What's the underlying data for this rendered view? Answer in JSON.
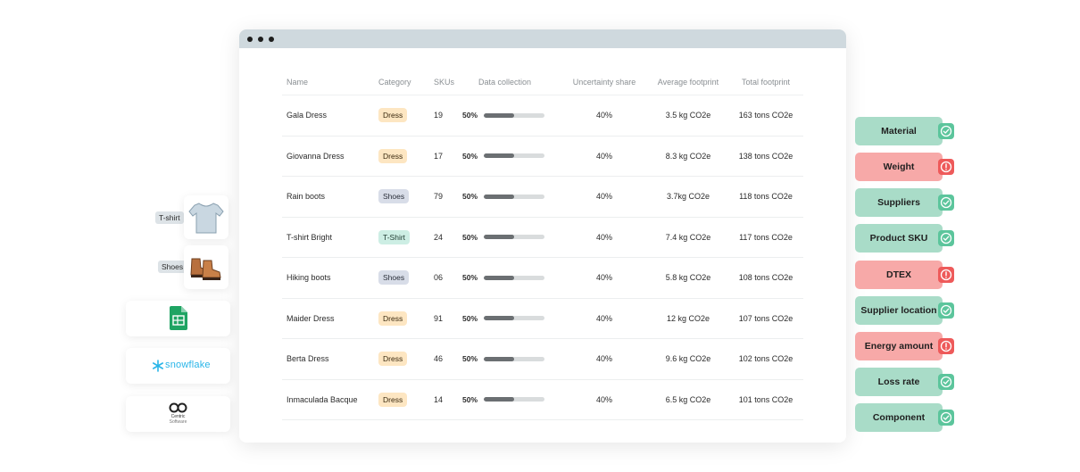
{
  "table": {
    "headers": [
      "Name",
      "Category",
      "SKUs",
      "Data collection",
      "Uncertainty share",
      "Average footprint",
      "Total footprint"
    ],
    "rows": [
      {
        "name": "Gala Dress",
        "category": "Dress",
        "cat_type": "dress",
        "skus": "19",
        "data_pct": "50%",
        "data_fill": 0.5,
        "uncertainty": "40%",
        "avg": "3.5 kg CO2e",
        "total": "163 tons CO2e"
      },
      {
        "name": "Giovanna Dress",
        "category": "Dress",
        "cat_type": "dress",
        "skus": "17",
        "data_pct": "50%",
        "data_fill": 0.5,
        "uncertainty": "40%",
        "avg": "8.3 kg CO2e",
        "total": "138 tons CO2e"
      },
      {
        "name": "Rain boots",
        "category": "Shoes",
        "cat_type": "shoes",
        "skus": "79",
        "data_pct": "50%",
        "data_fill": 0.5,
        "uncertainty": "40%",
        "avg": "3.7kg CO2e",
        "total": "118 tons CO2e"
      },
      {
        "name": "T-shirt Bright",
        "category": "T-Shirt",
        "cat_type": "tshirt",
        "skus": "24",
        "data_pct": "50%",
        "data_fill": 0.5,
        "uncertainty": "40%",
        "avg": "7.4 kg CO2e",
        "total": "117 tons CO2e"
      },
      {
        "name": "Hiking boots",
        "category": "Shoes",
        "cat_type": "shoes",
        "skus": "06",
        "data_pct": "50%",
        "data_fill": 0.5,
        "uncertainty": "40%",
        "avg": "5.8 kg CO2e",
        "total": "108 tons CO2e"
      },
      {
        "name": "Maider Dress",
        "category": "Dress",
        "cat_type": "dress",
        "skus": "91",
        "data_pct": "50%",
        "data_fill": 0.5,
        "uncertainty": "40%",
        "avg": "12 kg CO2e",
        "total": "107 tons CO2e"
      },
      {
        "name": "Berta Dress",
        "category": "Dress",
        "cat_type": "dress",
        "skus": "46",
        "data_pct": "50%",
        "data_fill": 0.5,
        "uncertainty": "40%",
        "avg": "9.6 kg CO2e",
        "total": "102 tons CO2e"
      },
      {
        "name": "Inmaculada Bacque",
        "category": "Dress",
        "cat_type": "dress",
        "skus": "14",
        "data_pct": "50%",
        "data_fill": 0.5,
        "uncertainty": "40%",
        "avg": "6.5 kg CO2e",
        "total": "101 tons CO2e"
      }
    ]
  },
  "sources": {
    "tshirt_tag": "T-shirt",
    "shoes_tag": "Shoes",
    "snowflake": "snowflake",
    "centric_name": "Centric",
    "centric_sub": "Software"
  },
  "checklist": [
    {
      "label": "Material",
      "status": "ok"
    },
    {
      "label": "Weight",
      "status": "bad"
    },
    {
      "label": "Suppliers",
      "status": "ok"
    },
    {
      "label": "Product SKU",
      "status": "ok"
    },
    {
      "label": "DTEX",
      "status": "bad"
    },
    {
      "label": "Supplier location",
      "status": "ok"
    },
    {
      "label": "Energy amount",
      "status": "bad"
    },
    {
      "label": "Loss rate",
      "status": "ok"
    },
    {
      "label": "Component",
      "status": "ok"
    }
  ],
  "colors": {
    "ok": "#a9dcc8",
    "bad": "#f7a9a8",
    "ok_icon": "#5cc59c",
    "bad_icon": "#ee5a5a"
  }
}
